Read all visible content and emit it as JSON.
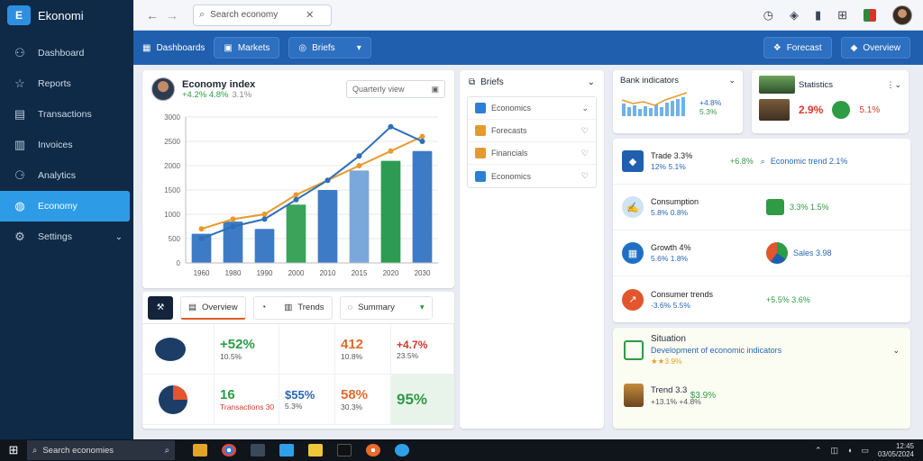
{
  "app": {
    "name": "Ekonomi"
  },
  "sidebar": {
    "items": [
      {
        "label": "Dashboard",
        "icon": "users-icon"
      },
      {
        "label": "Reports",
        "icon": "thumbs-up-icon"
      },
      {
        "label": "Transactions",
        "icon": "list-icon"
      },
      {
        "label": "Invoices",
        "icon": "receipt-icon"
      },
      {
        "label": "Analytics",
        "icon": "people-icon"
      },
      {
        "label": "Economy",
        "icon": "globe-icon",
        "active": true
      },
      {
        "label": "Settings",
        "icon": "gear-icon",
        "expandable": true
      }
    ]
  },
  "topbar": {
    "search_value": "Search economy"
  },
  "toolbar": {
    "left_label": "Dashboards",
    "btn1": "Markets",
    "btn2": "Briefs",
    "right1": "Forecast",
    "right2": "Overview"
  },
  "chart_panel": {
    "title": "Economy index",
    "subtitle": "+4.2% 4.8%",
    "subtitle_grey": "3.1%",
    "filter": "Quarterly view"
  },
  "chart_data": {
    "type": "bar",
    "categories": [
      "1960",
      "1980",
      "1990",
      "2000",
      "2010",
      "2015",
      "2020",
      "2030"
    ],
    "ylim": [
      0,
      3000
    ],
    "yticks": [
      "0",
      "500",
      "1000",
      "1500",
      "2000",
      "2500",
      "3000"
    ],
    "series": [
      {
        "values": [
          600,
          850,
          700,
          1200,
          1500,
          1900,
          2100,
          2300
        ]
      }
    ],
    "line_series": [
      {
        "values": [
          700,
          900,
          1000,
          1400,
          1700,
          2000,
          2300,
          2600
        ],
        "color": "#e89a2c"
      },
      {
        "values": [
          500,
          750,
          900,
          1300,
          1700,
          2200,
          2800,
          2500
        ],
        "color": "#2d6fb7"
      }
    ],
    "grid": true
  },
  "metrics": {
    "tabs": [
      "Overview",
      "Trends",
      "Summary"
    ],
    "rows": [
      {
        "c1": "+52%",
        "c1s": "10.5%",
        "c2": "",
        "c3": "412",
        "c3s": "10.8%",
        "c4": "+4.7%",
        "c4s": "23.5%"
      },
      {
        "c1": "16",
        "c1s": "Transactions 30",
        "c2": "$55%",
        "c2s": "5.3%",
        "c3": "58%",
        "c3s": "30.3%",
        "c4": "95%",
        "c4s": ""
      }
    ]
  },
  "list_panel": {
    "title": "Briefs",
    "items": [
      "Economics",
      "Forecasts",
      "Financials",
      "Economics"
    ]
  },
  "mini1": {
    "title": "Bank indicators",
    "v1": "+4.8%",
    "v2": "5.3%"
  },
  "mini2": {
    "title": "Statistics",
    "v1": "2.9%",
    "v2": "5.1%"
  },
  "stats": {
    "rows": [
      {
        "title": "Trade 3.3%",
        "sub": "12% 5.1%",
        "v": "+6.8%",
        "r": "Economic trend 2.1%"
      },
      {
        "title": "Consumption",
        "sub": "5.8% 0.8%",
        "v": "",
        "r": "3.3% 1.5%"
      },
      {
        "title": "Growth 4%",
        "sub": "5.6% 1.8%",
        "v": "",
        "r": "Sales 3.98"
      },
      {
        "title": "Consumer trends",
        "sub": "-3.6% 5.5%",
        "v": "",
        "r": "+5.5% 3.6%"
      }
    ]
  },
  "news": {
    "title": "Situation",
    "sub": "Development of economic indicators",
    "rating": "★★3.9%",
    "item2_title": "Trend 3.3",
    "item2_val": "$3.9%",
    "item2_sub": "+13.1% +4.8%"
  },
  "taskbar": {
    "search": "Search economies",
    "time": "12:45",
    "date": "03/05/2024"
  }
}
